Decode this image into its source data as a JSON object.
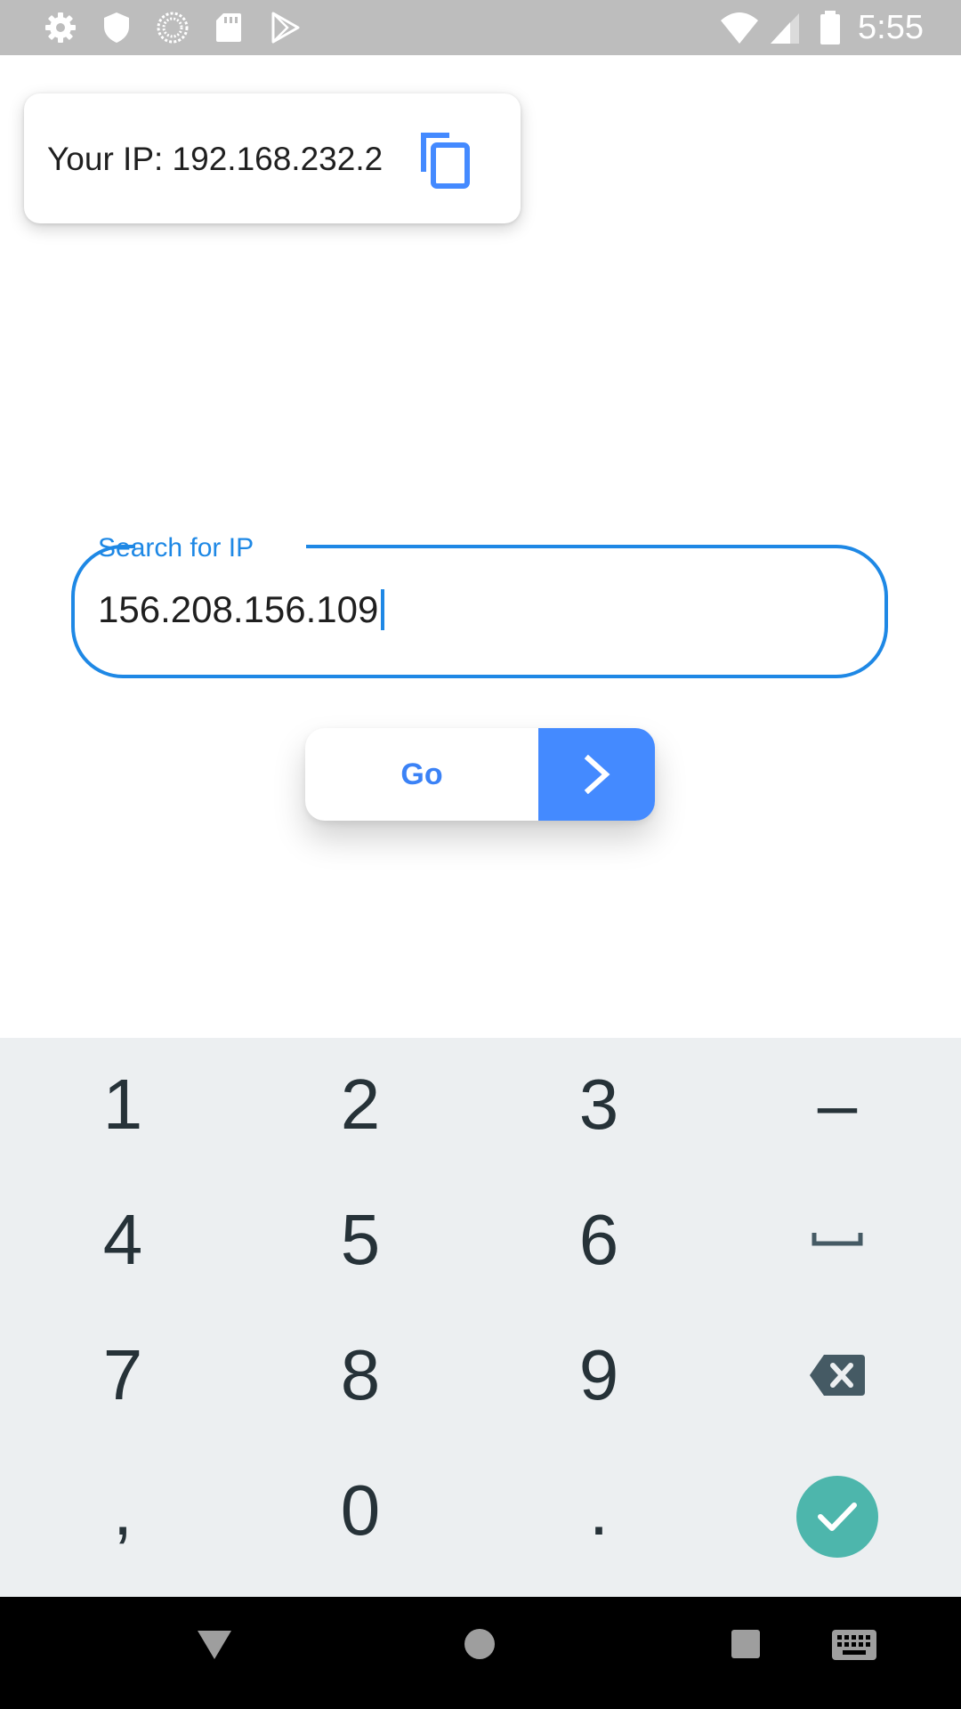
{
  "status_bar": {
    "time": "5:55",
    "icons_left": [
      "settings-icon",
      "shield-icon",
      "sync-icon",
      "sd-card-icon",
      "play-store-icon"
    ],
    "icons_right": [
      "wifi-icon",
      "cell-signal-icon",
      "battery-icon"
    ],
    "background": "#bdbdbd"
  },
  "ip_card": {
    "text": "Your IP: 192.168.232.2",
    "copy_icon": "copy-icon",
    "accent": "#448aff"
  },
  "search": {
    "label": "Search for IP",
    "value": "156.208.156.109",
    "accent": "#1e88e5"
  },
  "go_button": {
    "label": "Go",
    "icon": "chevron-right-icon",
    "accent": "#448aff"
  },
  "keyboard": {
    "rows": [
      [
        "1",
        "2",
        "3",
        "–"
      ],
      [
        "4",
        "5",
        "6",
        "space"
      ],
      [
        "7",
        "8",
        "9",
        "backspace"
      ],
      [
        ",",
        "0",
        ".",
        "done"
      ]
    ],
    "done_color": "#4db6ac"
  },
  "nav_bar": {
    "buttons": [
      "back-icon",
      "home-icon",
      "recents-icon",
      "keyboard-icon"
    ]
  }
}
